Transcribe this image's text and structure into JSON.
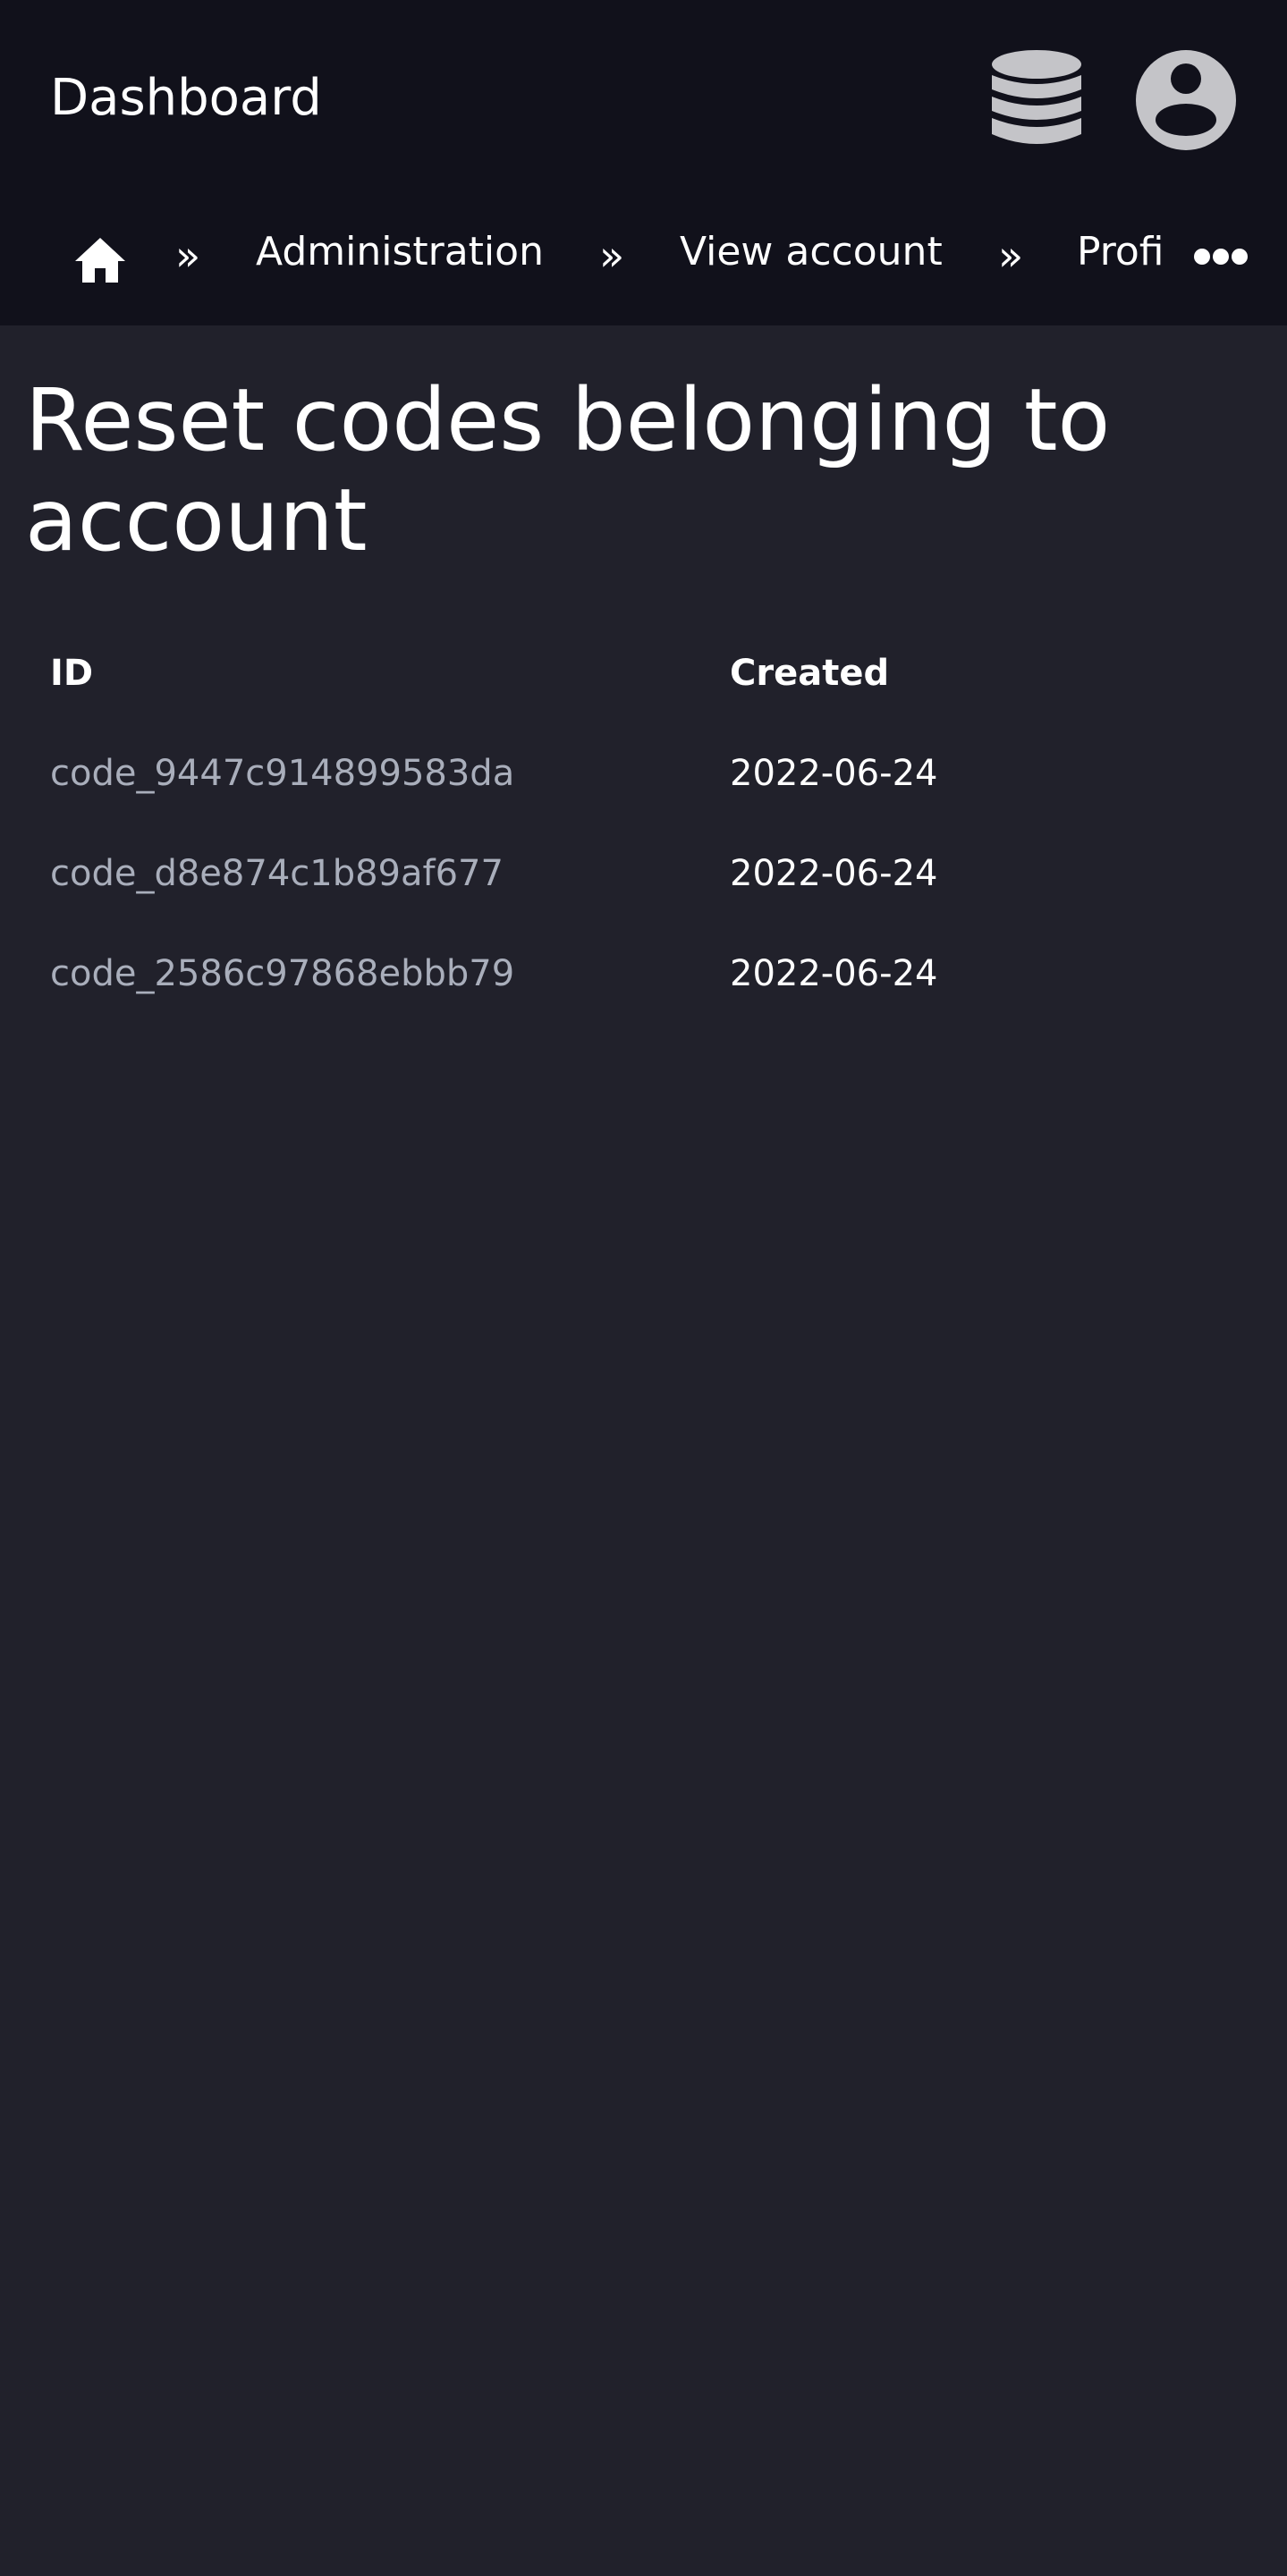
{
  "header": {
    "brand": "Dashboard",
    "database_icon": "database-icon",
    "account_icon": "user-circle-icon"
  },
  "breadcrumb": {
    "home_icon": "home-icon",
    "separator": "»",
    "items": [
      "Administration",
      "View account",
      "Profi"
    ],
    "more_icon": "ellipsis-icon"
  },
  "page": {
    "title": "Reset codes belonging to account"
  },
  "table": {
    "columns": [
      "ID",
      "Created"
    ],
    "rows": [
      {
        "id": "code_9447c914899583da",
        "created": "2022-06-24"
      },
      {
        "id": "code_d8e874c1b89af677",
        "created": "2022-06-24"
      },
      {
        "id": "code_2586c97868ebbb79",
        "created": "2022-06-24"
      }
    ]
  },
  "colors": {
    "header_bg": "#11111b",
    "page_bg": "#21212b",
    "icon_gray": "#c4c4c8",
    "link_muted": "#a9aebb"
  }
}
